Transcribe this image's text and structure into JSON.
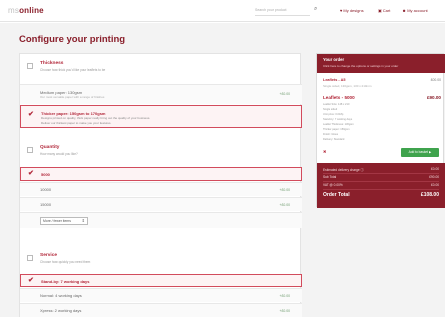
{
  "header": {
    "logo_prefix": "ms",
    "logo_main": "online",
    "search_placeholder": "Search your product",
    "search_icon": "search-icon",
    "nav": [
      {
        "label": "My designs",
        "icon": "heart-icon"
      },
      {
        "label": "Cart",
        "icon": "cart-icon"
      },
      {
        "label": "My account",
        "icon": "user-icon"
      }
    ]
  },
  "page": {
    "title": "Configure your printing"
  },
  "sections": {
    "thickness": {
      "title": "Thickness",
      "subtitle": "Choose how thick you'd like your leaflets to be",
      "options": [
        {
          "label": "Medium paper: 130gsm",
          "desc": "Our most versatile paper with a range of finishes",
          "price": "+£0.00"
        },
        {
          "label": "Thicker paper: 150gsm to 170gsm",
          "desc": "Designs printed on quality, thick paper really bring out the quality of your business.",
          "desc2": "Deliver our thickest paper to make you your features.",
          "selected": true
        }
      ]
    },
    "quantity": {
      "title": "Quantity",
      "subtitle": "How many would you like?",
      "options": [
        {
          "label": "5000",
          "selected": true
        },
        {
          "label": "10000",
          "price": "+£0.00"
        },
        {
          "label": "15000",
          "price": "+£0.00"
        }
      ],
      "select_label": "More / fewer items"
    },
    "service": {
      "title": "Service",
      "subtitle": "Choose how quickly you need them",
      "options": [
        {
          "label": "Stand-by: 7 working days",
          "selected": true
        },
        {
          "label": "Normal: 4 working days",
          "price": "+£0.00"
        },
        {
          "label": "Xpress: 2 working days",
          "price": "+£0.00"
        }
      ]
    }
  },
  "order": {
    "title": "Your order",
    "subtitle": "Click here to change the options or settings in your order",
    "line1": {
      "name": "Leaflets - A5",
      "price": "£00.00",
      "desc": "Single sided, 130gsm, 130 x 210mm"
    },
    "line2": {
      "name": "Leaflets - 5000",
      "price": "£90.00"
    },
    "specs": [
      "Leaflet Size: 148 x 210",
      "Single sided",
      "Unit price: 0.018p",
      "Stand-by: 7 working days",
      "Leaflet Thickness: 130gsm",
      "Thicker paper: 150gsm",
      "Finish: Gloss",
      "Delivery: Standard"
    ],
    "remove_label": "✖",
    "add_button": "Add to basket ▶",
    "totals": [
      {
        "label": "Estimated delivery charge ⓘ",
        "value": "£0.00"
      },
      {
        "label": "Sub Total",
        "value": "£90.00"
      },
      {
        "label": "VAT @ 0.00%",
        "value": "£0.00"
      }
    ],
    "total": {
      "label": "Order Total",
      "value": "£108.00"
    }
  },
  "colors": {
    "brand": "#8a1f2b",
    "accent": "#b2283a",
    "success": "#3fa34d",
    "background": "#f3f3f3"
  }
}
